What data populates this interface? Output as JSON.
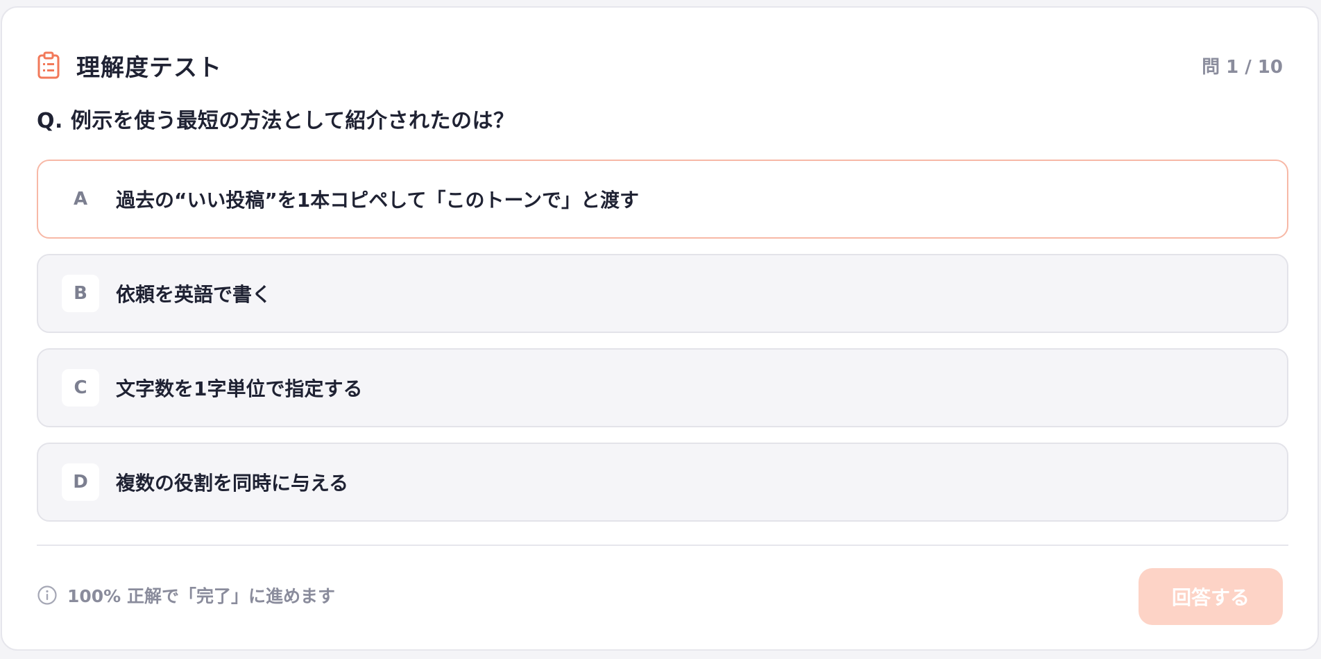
{
  "quiz": {
    "title": "理解度テスト",
    "progress": "問 1 / 10",
    "question": "Q. 例示を使う最短の方法として紹介されたのは？",
    "options": [
      {
        "letter": "A",
        "text": "過去の“いい投稿”を1本コピペして「このトーンで」と渡す",
        "selected": true
      },
      {
        "letter": "B",
        "text": "依頼を英語で書く",
        "selected": false
      },
      {
        "letter": "C",
        "text": "文字数を1字単位で指定する",
        "selected": false
      },
      {
        "letter": "D",
        "text": "複数の役割を同時に与える",
        "selected": false
      }
    ]
  },
  "footer": {
    "note": "100% 正解で「完了」に進めます",
    "submit_label": "回答する"
  },
  "colors": {
    "accent": "#f2795a",
    "selected_border": "#f7b8a6",
    "submit_disabled": "#fdd3c6",
    "muted_text": "#8a8c9c"
  },
  "icons": {
    "header": "clipboard-icon",
    "footer": "info-icon"
  }
}
